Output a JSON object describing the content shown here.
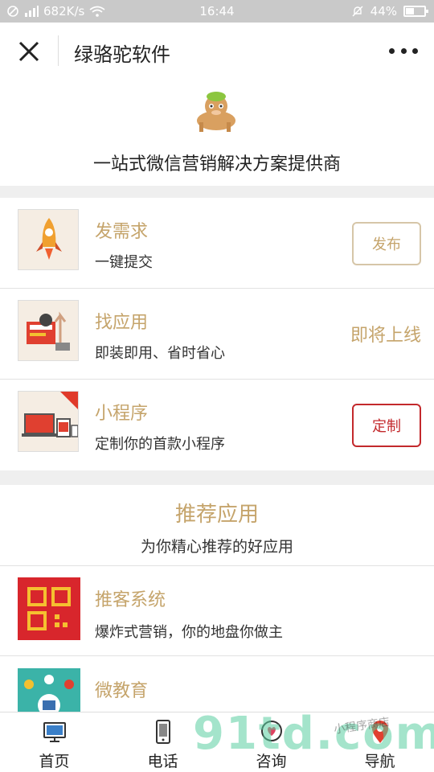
{
  "status_bar": {
    "network_speed": "682K/s",
    "time": "16:44",
    "battery": "44%",
    "battery_level": 0.44
  },
  "nav": {
    "title": "绿骆驼软件"
  },
  "header": {
    "slogan": "一站式微信营销解决方案提供商"
  },
  "services": [
    {
      "title": "发需求",
      "subtitle": "一键提交",
      "action": "发布"
    },
    {
      "title": "找应用",
      "subtitle": "即装即用、省时省心",
      "status": "即将上线"
    },
    {
      "title": "小程序",
      "subtitle": "定制你的首款小程序",
      "action": "定制"
    }
  ],
  "recommend": {
    "title": "推荐应用",
    "subtitle": "为你精心推荐的好应用",
    "apps": [
      {
        "title": "推客系统",
        "subtitle": "爆炸式营销，你的地盘你做主"
      },
      {
        "title": "微教育",
        "subtitle": ""
      }
    ]
  },
  "tabs": [
    {
      "label": "首页",
      "icon": "monitor-icon"
    },
    {
      "label": "电话",
      "icon": "phone-icon"
    },
    {
      "label": "咨询",
      "icon": "chat-icon"
    },
    {
      "label": "导航",
      "icon": "location-pin-icon"
    }
  ],
  "watermark": {
    "text": "91td.com",
    "small_text": "小程序商店"
  },
  "colors": {
    "accent_gold": "#c5a46b",
    "red": "#c3292c",
    "status_gray": "#c9c9c9"
  }
}
